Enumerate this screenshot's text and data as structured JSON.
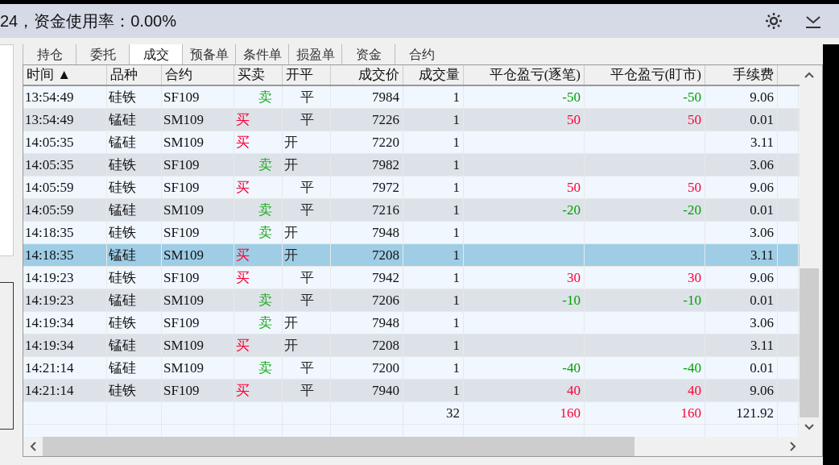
{
  "header": {
    "summary": "24，资金使用率：0.00%"
  },
  "tabs": [
    {
      "label": "持仓",
      "selected": false
    },
    {
      "label": "委托",
      "selected": false
    },
    {
      "label": "成交",
      "selected": true
    },
    {
      "label": "预备单",
      "selected": false
    },
    {
      "label": "条件单",
      "selected": false
    },
    {
      "label": "损盈单",
      "selected": false
    },
    {
      "label": "资金",
      "selected": false
    },
    {
      "label": "合约",
      "selected": false
    }
  ],
  "table": {
    "columns": [
      "时间 ▲",
      "品种",
      "合约",
      "买卖",
      "开平",
      "成交价",
      "成交量",
      "平仓盈亏(逐笔)",
      "平仓盈亏(盯市)",
      "手续费"
    ],
    "rows": [
      {
        "time": "13:54:49",
        "product": "硅铁",
        "contract": "SF109",
        "side": {
          "text": "卖",
          "kind": "sell"
        },
        "oc": {
          "text": "平",
          "kind": "close"
        },
        "price": "7984",
        "qty": "1",
        "pnl_trade": {
          "text": "-50",
          "color": "#00a000"
        },
        "pnl_mark": {
          "text": "-50",
          "color": "#00a000"
        },
        "fee": "9.06",
        "selected": false
      },
      {
        "time": "13:54:49",
        "product": "锰硅",
        "contract": "SM109",
        "side": {
          "text": "买",
          "kind": "buy"
        },
        "oc": {
          "text": "平",
          "kind": "close"
        },
        "price": "7226",
        "qty": "1",
        "pnl_trade": {
          "text": "50",
          "color": "#ff0033"
        },
        "pnl_mark": {
          "text": "50",
          "color": "#ff0033"
        },
        "fee": "0.01",
        "selected": false
      },
      {
        "time": "14:05:35",
        "product": "锰硅",
        "contract": "SM109",
        "side": {
          "text": "买",
          "kind": "buy"
        },
        "oc": {
          "text": "开",
          "kind": "open"
        },
        "price": "7220",
        "qty": "1",
        "fee": "3.11",
        "selected": false
      },
      {
        "time": "14:05:35",
        "product": "硅铁",
        "contract": "SF109",
        "side": {
          "text": "卖",
          "kind": "sell"
        },
        "oc": {
          "text": "开",
          "kind": "open"
        },
        "price": "7982",
        "qty": "1",
        "fee": "3.06",
        "selected": false
      },
      {
        "time": "14:05:59",
        "product": "硅铁",
        "contract": "SF109",
        "side": {
          "text": "买",
          "kind": "buy"
        },
        "oc": {
          "text": "平",
          "kind": "close"
        },
        "price": "7972",
        "qty": "1",
        "pnl_trade": {
          "text": "50",
          "color": "#ff0033"
        },
        "pnl_mark": {
          "text": "50",
          "color": "#ff0033"
        },
        "fee": "9.06",
        "selected": false
      },
      {
        "time": "14:05:59",
        "product": "锰硅",
        "contract": "SM109",
        "side": {
          "text": "卖",
          "kind": "sell"
        },
        "oc": {
          "text": "平",
          "kind": "close"
        },
        "price": "7216",
        "qty": "1",
        "pnl_trade": {
          "text": "-20",
          "color": "#00a000"
        },
        "pnl_mark": {
          "text": "-20",
          "color": "#00a000"
        },
        "fee": "0.01",
        "selected": false
      },
      {
        "time": "14:18:35",
        "product": "硅铁",
        "contract": "SF109",
        "side": {
          "text": "卖",
          "kind": "sell"
        },
        "oc": {
          "text": "开",
          "kind": "open"
        },
        "price": "7948",
        "qty": "1",
        "fee": "3.06",
        "selected": false
      },
      {
        "time": "14:18:35",
        "product": "锰硅",
        "contract": "SM109",
        "side": {
          "text": "买",
          "kind": "buy"
        },
        "oc": {
          "text": "开",
          "kind": "open"
        },
        "price": "7208",
        "qty": "1",
        "fee": "3.11",
        "selected": true
      },
      {
        "time": "14:19:23",
        "product": "硅铁",
        "contract": "SF109",
        "side": {
          "text": "买",
          "kind": "buy"
        },
        "oc": {
          "text": "平",
          "kind": "close"
        },
        "price": "7942",
        "qty": "1",
        "pnl_trade": {
          "text": "30",
          "color": "#ff0033"
        },
        "pnl_mark": {
          "text": "30",
          "color": "#ff0033"
        },
        "fee": "9.06",
        "selected": false
      },
      {
        "time": "14:19:23",
        "product": "锰硅",
        "contract": "SM109",
        "side": {
          "text": "卖",
          "kind": "sell"
        },
        "oc": {
          "text": "平",
          "kind": "close"
        },
        "price": "7206",
        "qty": "1",
        "pnl_trade": {
          "text": "-10",
          "color": "#00a000"
        },
        "pnl_mark": {
          "text": "-10",
          "color": "#00a000"
        },
        "fee": "0.01",
        "selected": false
      },
      {
        "time": "14:19:34",
        "product": "硅铁",
        "contract": "SF109",
        "side": {
          "text": "卖",
          "kind": "sell"
        },
        "oc": {
          "text": "开",
          "kind": "open"
        },
        "price": "7948",
        "qty": "1",
        "fee": "3.06",
        "selected": false
      },
      {
        "time": "14:19:34",
        "product": "锰硅",
        "contract": "SM109",
        "side": {
          "text": "买",
          "kind": "buy"
        },
        "oc": {
          "text": "开",
          "kind": "open"
        },
        "price": "7208",
        "qty": "1",
        "fee": "3.11",
        "selected": false
      },
      {
        "time": "14:21:14",
        "product": "锰硅",
        "contract": "SM109",
        "side": {
          "text": "卖",
          "kind": "sell"
        },
        "oc": {
          "text": "平",
          "kind": "close"
        },
        "price": "7200",
        "qty": "1",
        "pnl_trade": {
          "text": "-40",
          "color": "#00a000"
        },
        "pnl_mark": {
          "text": "-40",
          "color": "#00a000"
        },
        "fee": "0.01",
        "selected": false
      },
      {
        "time": "14:21:14",
        "product": "硅铁",
        "contract": "SF109",
        "side": {
          "text": "买",
          "kind": "buy"
        },
        "oc": {
          "text": "平",
          "kind": "close"
        },
        "price": "7940",
        "qty": "1",
        "pnl_trade": {
          "text": "40",
          "color": "#ff0033"
        },
        "pnl_mark": {
          "text": "40",
          "color": "#ff0033"
        },
        "fee": "9.06",
        "selected": false
      }
    ],
    "totals": {
      "qty": "32",
      "pnl_trade": {
        "text": "160",
        "color": "#ff0033"
      },
      "pnl_mark": {
        "text": "160",
        "color": "#ff0033"
      },
      "fee": "121.92"
    }
  }
}
